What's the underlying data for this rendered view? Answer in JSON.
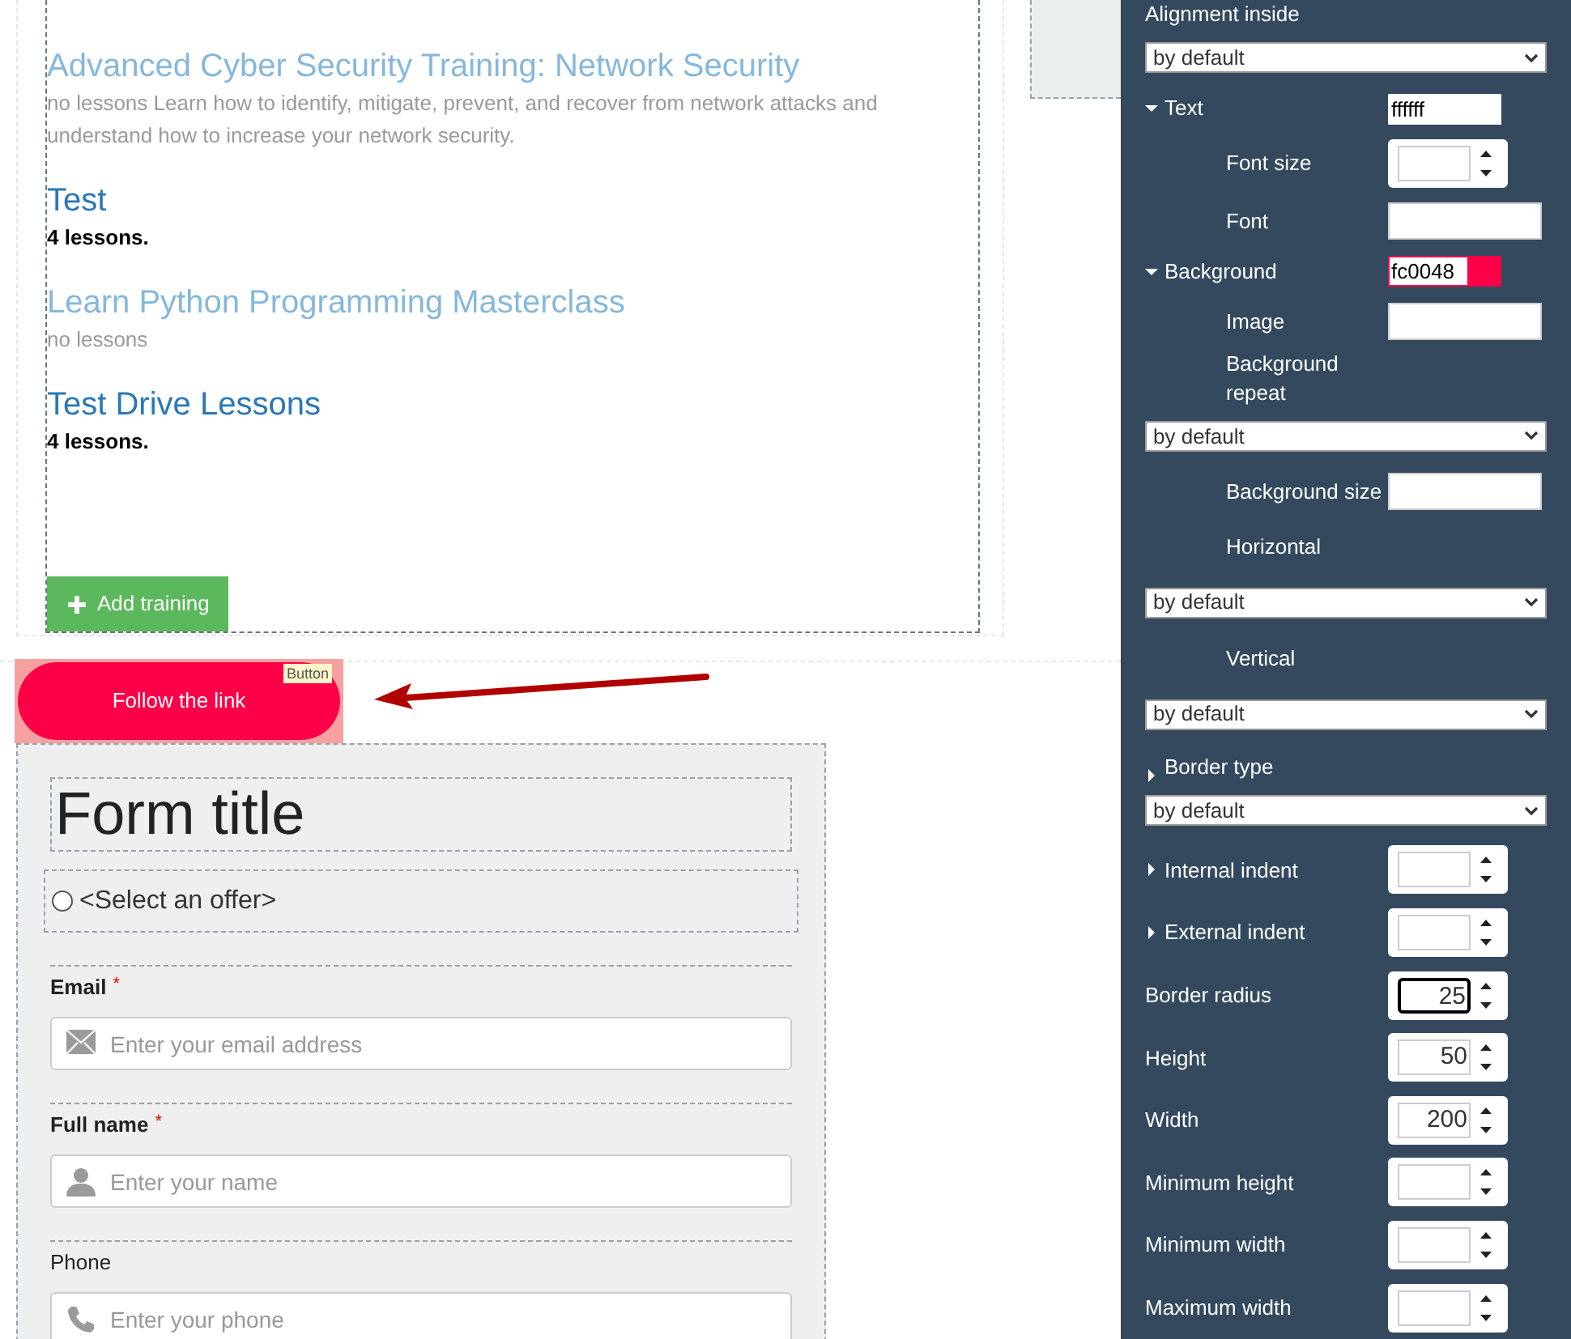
{
  "trainings": [
    {
      "title": "Advanced Cyber Security Training: Network Security",
      "subtitle": "no lessons Learn how to identify, mitigate, prevent, and recover from network attacks and understand how to increase your network security.",
      "muted": true
    },
    {
      "title": "Test",
      "subtitle": "4 lessons.",
      "muted": false
    },
    {
      "title": "Learn Python Programming Masterclass",
      "subtitle": "no lessons",
      "muted": true
    },
    {
      "title": "Test Drive Lessons",
      "subtitle": "4 lessons.",
      "muted": false
    }
  ],
  "add_button": {
    "label": "Add training"
  },
  "link_button": {
    "label": "Follow the link",
    "tag": "Button",
    "selected": true
  },
  "form": {
    "title": "Form title",
    "offer": {
      "label": "<Select an offer>",
      "checked": false
    },
    "fields": [
      {
        "kind": "email",
        "label": "Email",
        "required": true,
        "required_mark": "*",
        "placeholder": "Enter your email address"
      },
      {
        "kind": "name",
        "label": "Full name",
        "required": true,
        "required_mark": "*",
        "placeholder": "Enter your name"
      },
      {
        "kind": "phone",
        "label": "Phone",
        "required": false,
        "placeholder": "Enter your phone"
      }
    ]
  },
  "panel": {
    "rows": [
      {
        "kind": "label",
        "label": "Alignment inside"
      },
      {
        "kind": "select",
        "value": "by default"
      },
      {
        "kind": "color",
        "label": "Text",
        "expanded": true,
        "value": "ffffff",
        "color": "#ffffff",
        "children": [
          {
            "kind": "spin",
            "label": "Font size",
            "focused": false
          },
          {
            "kind": "text",
            "label": "Font"
          }
        ]
      },
      {
        "kind": "color",
        "label": "Background",
        "expanded": true,
        "value": "fc0048",
        "color": "#fc0048",
        "children": [
          {
            "kind": "text",
            "label": "Image"
          },
          {
            "kind": "label",
            "label": "Background repeat"
          },
          {
            "kind": "select",
            "value": "by default"
          },
          {
            "kind": "text",
            "label": "Background size"
          },
          {
            "kind": "label",
            "label": "Horizontal"
          },
          {
            "kind": "select",
            "value": "by default"
          },
          {
            "kind": "label",
            "label": "Vertical"
          },
          {
            "kind": "select",
            "value": "by default"
          }
        ]
      },
      {
        "kind": "section",
        "label": "Border type",
        "expanded": false
      },
      {
        "kind": "select",
        "value": "by default"
      },
      {
        "kind": "spin",
        "label": "Internal indent",
        "expanded": false,
        "focused": false
      },
      {
        "kind": "spin",
        "label": "External indent",
        "expanded": false,
        "focused": false
      },
      {
        "kind": "spin",
        "label": "Border radius",
        "value": "25",
        "focused": true
      },
      {
        "kind": "spin",
        "label": "Height",
        "value": "50",
        "focused": false
      },
      {
        "kind": "spin",
        "label": "Width",
        "value": "200",
        "focused": false
      },
      {
        "kind": "spin",
        "label": "Minimum height",
        "focused": false
      },
      {
        "kind": "spin",
        "label": "Minimum width",
        "focused": false
      },
      {
        "kind": "spin",
        "label": "Maximum width",
        "focused": false
      }
    ]
  }
}
